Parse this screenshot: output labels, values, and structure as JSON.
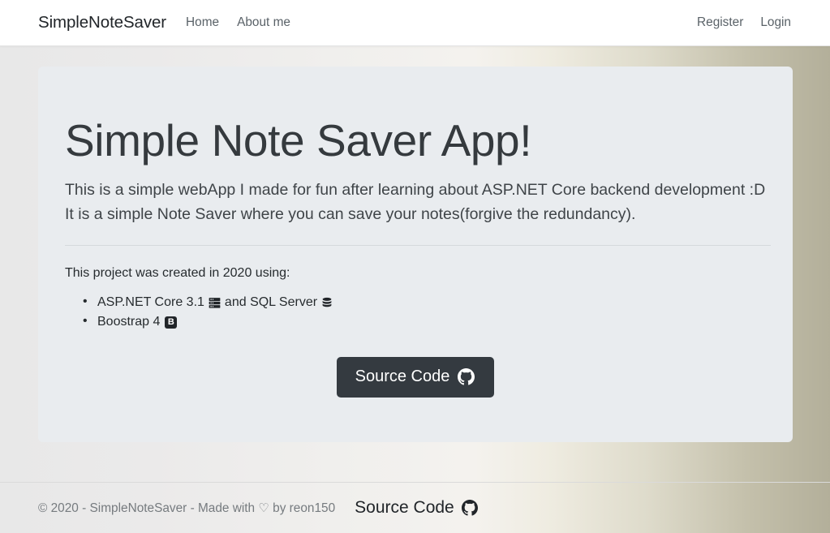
{
  "navbar": {
    "brand": "SimpleNoteSaver",
    "left_links": [
      {
        "label": "Home"
      },
      {
        "label": "About me"
      }
    ],
    "right_links": [
      {
        "label": "Register"
      },
      {
        "label": "Login"
      }
    ]
  },
  "hero": {
    "title": "Simple Note Saver App!",
    "lead_line_1": "This is a simple webApp I made for fun after learning about ASP.NET Core backend development :D",
    "lead_line_2": "It is a simple Note Saver where you can save your notes(forgive the redundancy).",
    "project_intro": "This project was created in 2020 using:",
    "tech_items": [
      {
        "text_before": "ASP.NET Core 3.1",
        "icon_1": "server-icon",
        "text_middle": "and SQL Server",
        "icon_2": "database-icon"
      },
      {
        "text_before": "Boostrap 4",
        "icon_1": "bootstrap-icon",
        "badge_letter": "B"
      }
    ],
    "source_button": {
      "label": "Source Code",
      "icon": "github-icon"
    }
  },
  "footer": {
    "copyright_before": "© 2020 - SimpleNoteSaver - Made with",
    "heart": "♡",
    "copyright_after": "by reon150",
    "source_link": {
      "label": "Source Code",
      "icon": "github-icon"
    }
  },
  "colors": {
    "navbar_bg": "#ffffff",
    "card_bg": "#e9ecef",
    "button_dark": "#343a40",
    "body_text": "#262b2e",
    "muted_text": "#767b7f",
    "background_left": "#e8e8e8",
    "background_right": "#b3af9a"
  }
}
